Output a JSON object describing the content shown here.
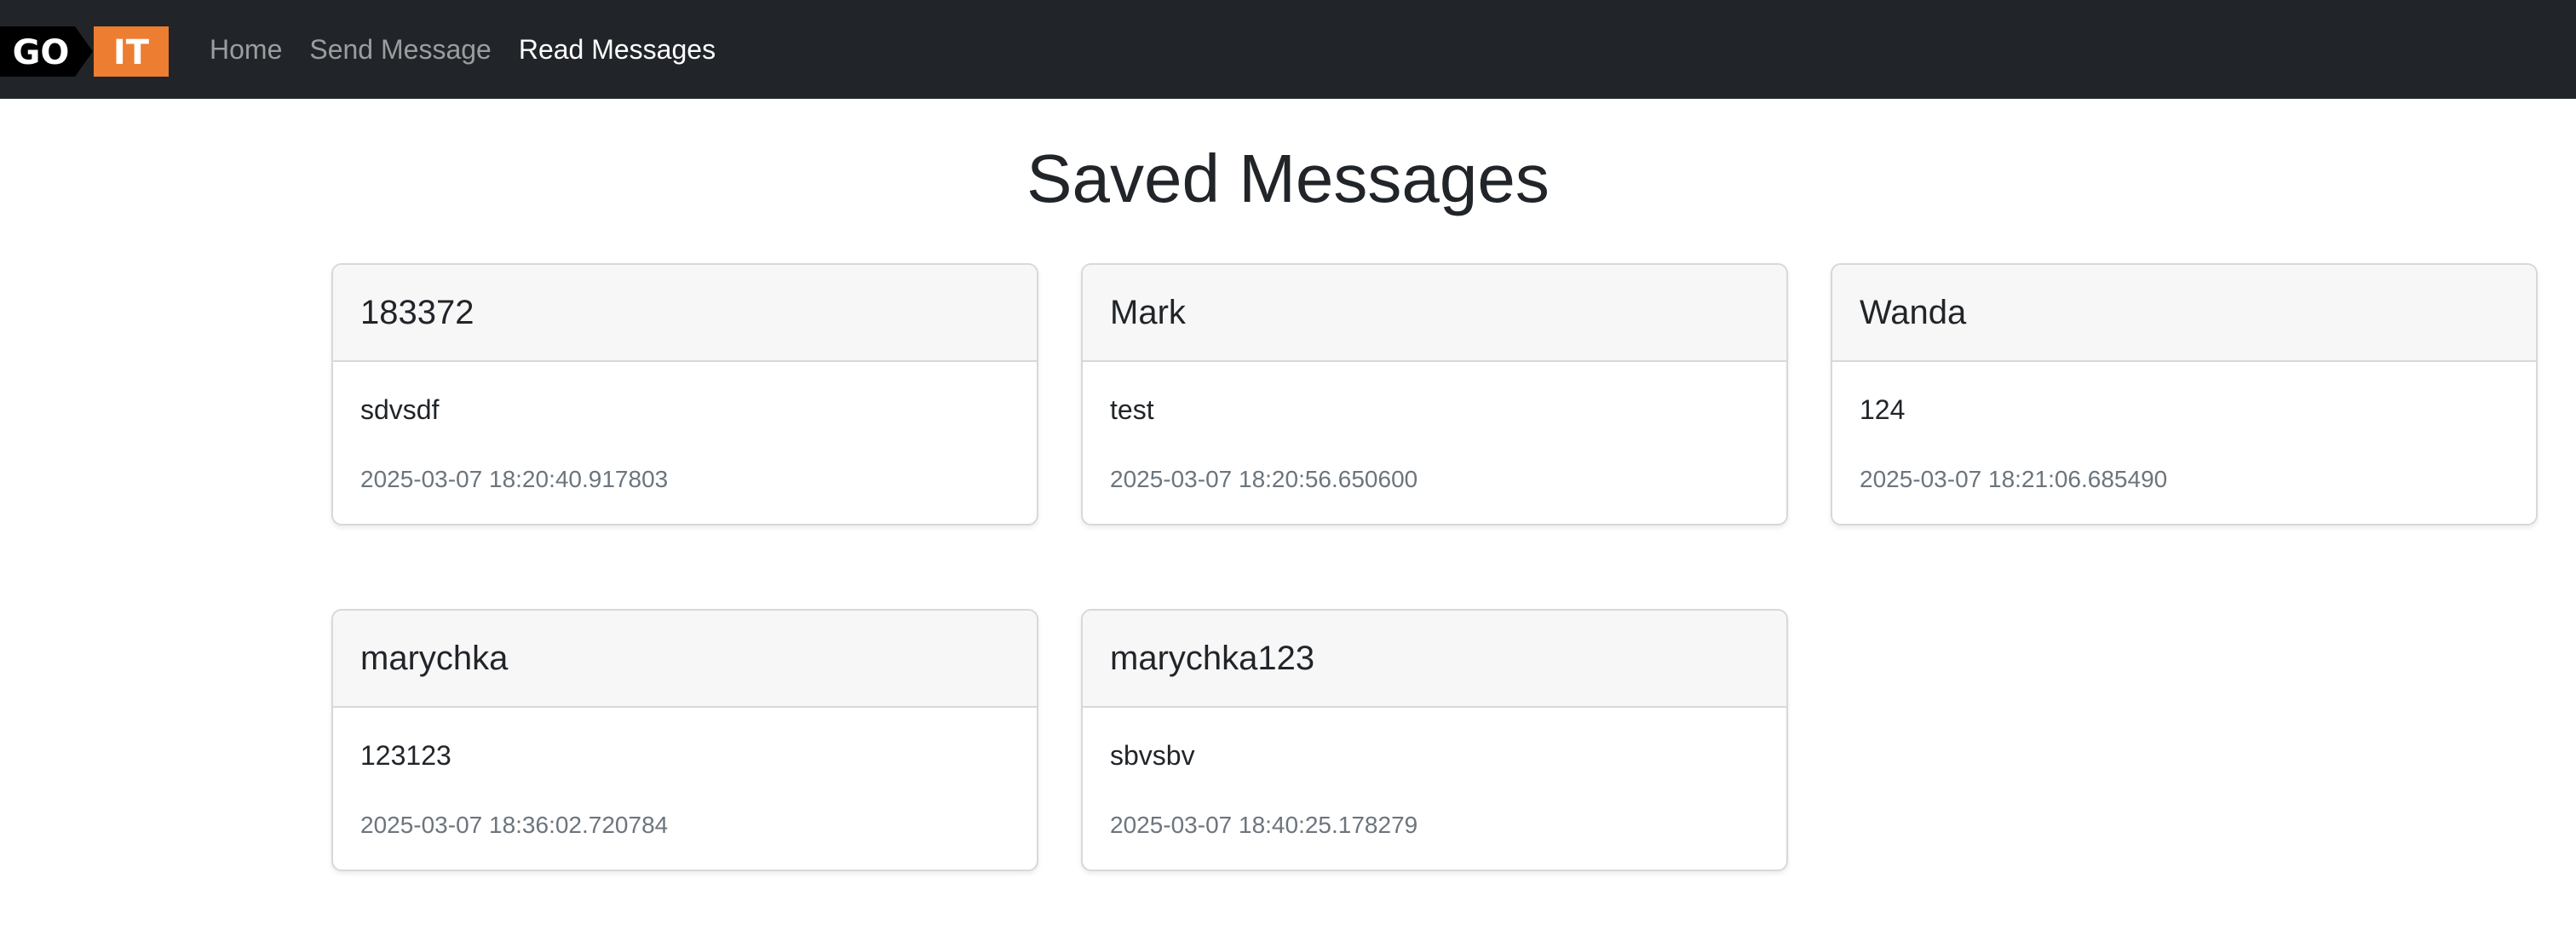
{
  "nav": {
    "logo": {
      "left_text": "GO",
      "right_text": "IT",
      "accent": "#ed7d31"
    },
    "links": [
      {
        "label": "Home",
        "active": false
      },
      {
        "label": "Send Message",
        "active": false
      },
      {
        "label": "Read Messages",
        "active": true
      }
    ]
  },
  "page": {
    "title": "Saved Messages"
  },
  "messages": [
    {
      "username": "183372",
      "message": "sdvsdf",
      "timestamp": "2025-03-07 18:20:40.917803"
    },
    {
      "username": "Mark",
      "message": "test",
      "timestamp": "2025-03-07 18:20:56.650600"
    },
    {
      "username": "Wanda",
      "message": "124",
      "timestamp": "2025-03-07 18:21:06.685490"
    },
    {
      "username": "marychka",
      "message": "123123",
      "timestamp": "2025-03-07 18:36:02.720784"
    },
    {
      "username": "marychka123",
      "message": "sbvsbv",
      "timestamp": "2025-03-07 18:40:25.178279"
    }
  ],
  "colors": {
    "navbar_bg": "#212529",
    "card_header_bg": "#f7f7f8",
    "muted_text": "#6c757d"
  }
}
